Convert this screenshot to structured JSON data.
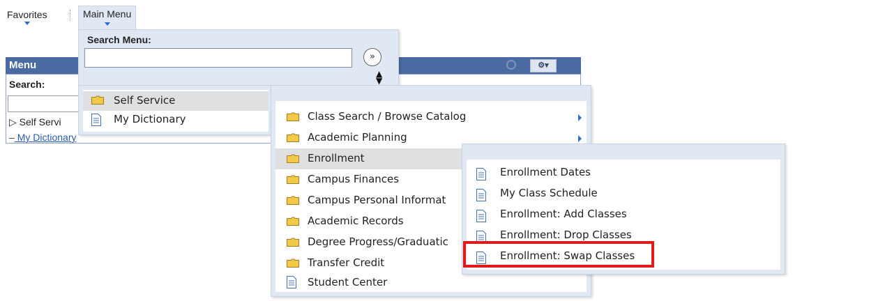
{
  "nav": {
    "favorites": "Favorites",
    "main_menu": "Main Menu"
  },
  "menu_pagelet": {
    "title": "Menu",
    "search_label": "Search:",
    "tree": [
      {
        "label": "Self Servi",
        "prefix": "▷"
      },
      {
        "label": "My Dictionary",
        "prefix": "–"
      }
    ]
  },
  "main_dropdown": {
    "search_label": "Search Menu:",
    "search_value": "",
    "go_icon": "double-chevron-right-icon",
    "sort_icon": "sort-updown-icon"
  },
  "level1": [
    {
      "label": "Self Service",
      "icon": "folder-icon",
      "selected": true
    },
    {
      "label": "My Dictionary",
      "icon": "document-icon",
      "selected": false
    }
  ],
  "level2": [
    {
      "label": "Class Search / Browse Catalog",
      "icon": "folder-icon",
      "has_submenu": true,
      "selected": false
    },
    {
      "label": "Academic Planning",
      "icon": "folder-icon",
      "has_submenu": true,
      "selected": false
    },
    {
      "label": "Enrollment",
      "icon": "folder-icon",
      "has_submenu": false,
      "selected": true
    },
    {
      "label": "Campus Finances",
      "icon": "folder-icon",
      "has_submenu": false,
      "selected": false
    },
    {
      "label": "Campus Personal Informat",
      "icon": "folder-icon",
      "has_submenu": false,
      "selected": false
    },
    {
      "label": "Academic Records",
      "icon": "folder-icon",
      "has_submenu": false,
      "selected": false
    },
    {
      "label": "Degree Progress/Graduatic",
      "icon": "folder-icon",
      "has_submenu": false,
      "selected": false
    },
    {
      "label": "Transfer Credit",
      "icon": "folder-icon",
      "has_submenu": false,
      "selected": false
    },
    {
      "label": "Student Center",
      "icon": "document-icon",
      "has_submenu": false,
      "selected": false
    }
  ],
  "level3": [
    {
      "label": "Enrollment Dates",
      "icon": "document-icon"
    },
    {
      "label": "My Class Schedule",
      "icon": "document-icon"
    },
    {
      "label": "Enrollment: Add Classes",
      "icon": "document-icon"
    },
    {
      "label": "Enrollment: Drop Classes",
      "icon": "document-icon"
    },
    {
      "label": "Enrollment: Swap Classes",
      "icon": "document-icon"
    }
  ],
  "colors": {
    "menu_header": "#4b6aa1",
    "dropdown_bg": "#dfe8f3",
    "selected_row": "#dfe0e2",
    "folder": "#f3c94a",
    "highlight": "#e11b1b",
    "link": "#2b5ba8"
  }
}
